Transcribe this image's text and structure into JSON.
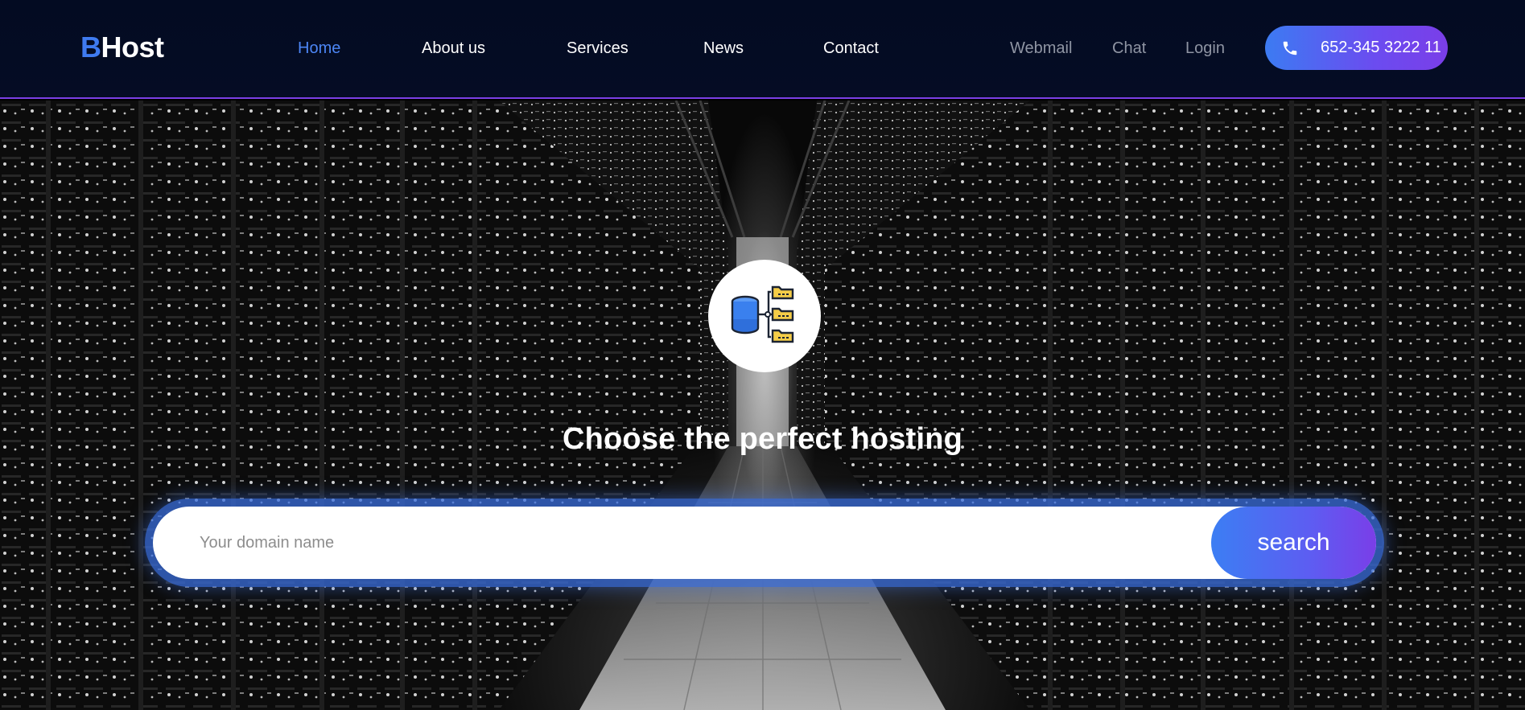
{
  "brand": {
    "logo_first": "B",
    "logo_rest": "Host"
  },
  "nav": {
    "items": [
      {
        "label": "Home",
        "active": true
      },
      {
        "label": "About us",
        "active": false
      },
      {
        "label": "Services",
        "active": false
      },
      {
        "label": "News",
        "active": false
      },
      {
        "label": "Contact",
        "active": false
      }
    ]
  },
  "utility": {
    "webmail": "Webmail",
    "chat": "Chat",
    "login": "Login",
    "phone": "652-345 3222 11",
    "phone_icon": "phone-icon"
  },
  "hero": {
    "icon": "database-hierarchy-icon",
    "title": "Choose the perfect hosting",
    "search_placeholder": "Your domain name",
    "search_value": "",
    "search_button": "search"
  },
  "colors": {
    "accent_blue": "#4c86f5",
    "accent_purple": "#7a3ee8",
    "header_bg": "#030b22",
    "icon_yellow": "#f5cd48",
    "icon_blue": "#3a80ee"
  }
}
